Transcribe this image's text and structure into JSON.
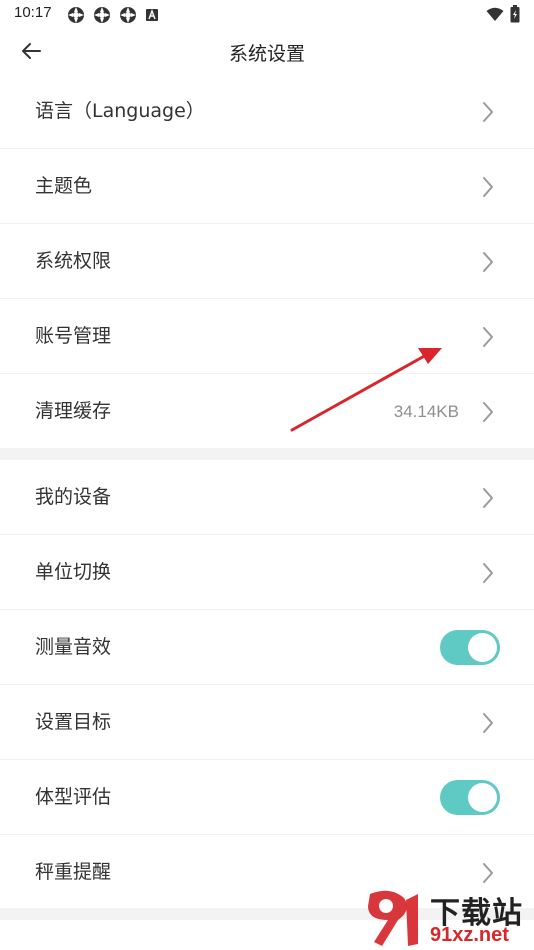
{
  "status_bar": {
    "time": "10:17"
  },
  "header": {
    "title": "系统设置"
  },
  "group1": [
    {
      "label": "语言（Language）",
      "value": ""
    },
    {
      "label": "主题色",
      "value": ""
    },
    {
      "label": "系统权限",
      "value": ""
    },
    {
      "label": "账号管理",
      "value": ""
    },
    {
      "label": "清理缓存",
      "value": "34.14KB"
    }
  ],
  "group2": [
    {
      "label": "我的设备",
      "control": "chevron"
    },
    {
      "label": "单位切换",
      "control": "chevron"
    },
    {
      "label": "测量音效",
      "control": "toggle",
      "on": true
    },
    {
      "label": "设置目标",
      "control": "chevron"
    },
    {
      "label": "体型评估",
      "control": "toggle",
      "on": true
    },
    {
      "label": "秤重提醒",
      "control": "chevron"
    }
  ],
  "watermark": {
    "top_text": "下载站",
    "bottom_text": "91xz.net"
  },
  "colors": {
    "toggle_on": "#5fc9c4",
    "annotation_arrow": "#d9262c",
    "separator_band": "#f3f3f3"
  }
}
